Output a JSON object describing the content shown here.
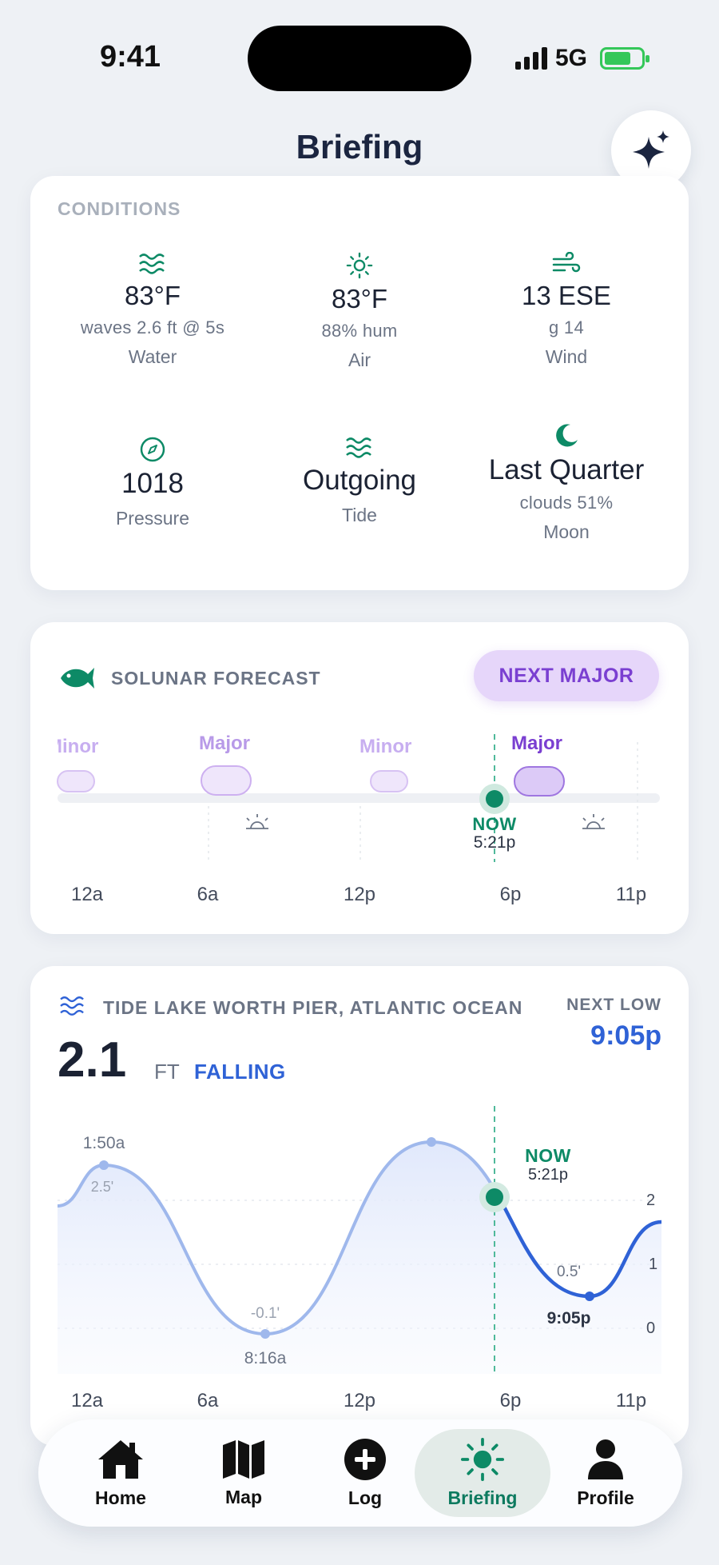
{
  "status": {
    "time": "9:41",
    "network": "5G"
  },
  "header": {
    "title": "Briefing"
  },
  "conditions": {
    "label": "CONDITIONS",
    "water": {
      "value": "83°F",
      "sub": "waves 2.6 ft @ 5s",
      "label": "Water"
    },
    "air": {
      "value": "83°F",
      "sub": "88% hum",
      "label": "Air"
    },
    "wind": {
      "value": "13 ESE",
      "sub": "g 14",
      "label": "Wind"
    },
    "pressure": {
      "value": "1018",
      "label": "Pressure"
    },
    "tide": {
      "value": "Outgoing",
      "label": "Tide"
    },
    "moon": {
      "value": "Last Quarter",
      "sub": "clouds 51%",
      "label": "Moon"
    }
  },
  "solunar": {
    "label": "SOLUNAR FORECAST",
    "next_button": "NEXT MAJOR",
    "periods": [
      "Minor",
      "Major",
      "Minor",
      "Major"
    ],
    "now_label": "NOW",
    "now_time": "5:21p",
    "ticks": [
      "12a",
      "6a",
      "12p",
      "6p",
      "11p"
    ]
  },
  "tide_card": {
    "label": "TIDE LAKE WORTH PIER, ATLANTIC OCEAN",
    "next_label": "NEXT LOW",
    "next_time": "9:05p",
    "height": "2.1",
    "unit": "FT",
    "trend": "FALLING",
    "now_label": "NOW",
    "now_time": "5:21p",
    "events": [
      {
        "time": "1:50a",
        "height": "2.5'"
      },
      {
        "time": "8:16a",
        "height": "-0.1'"
      },
      {
        "time": "9:05p",
        "height": "0.5'"
      }
    ],
    "y_ticks": [
      "2",
      "1",
      "0"
    ],
    "x_ticks": [
      "12a",
      "6a",
      "12p",
      "6p",
      "11p"
    ]
  },
  "nav": {
    "home": "Home",
    "map": "Map",
    "log": "Log",
    "briefing": "Briefing",
    "profile": "Profile"
  },
  "colors": {
    "accent_green": "#0d8a66",
    "purple": "#7a3fd1",
    "tide_blue": "#2f62d6"
  }
}
